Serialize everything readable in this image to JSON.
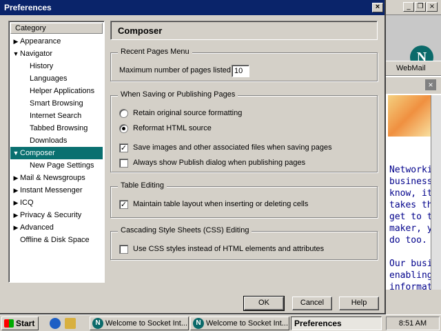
{
  "dialog": {
    "title": "Preferences",
    "close_glyph": "×",
    "category_header": "Category",
    "panel_title": "Composer",
    "buttons": {
      "ok": "OK",
      "cancel": "Cancel",
      "help": "Help"
    }
  },
  "tree": [
    {
      "label": "Appearance",
      "twisty": "▶",
      "selected": false
    },
    {
      "label": "Navigator",
      "twisty": "▼",
      "selected": false
    },
    {
      "label": "History",
      "twisty": "",
      "selected": false
    },
    {
      "label": "Languages",
      "twisty": "",
      "selected": false
    },
    {
      "label": "Helper Applications",
      "twisty": "",
      "selected": false
    },
    {
      "label": "Smart Browsing",
      "twisty": "",
      "selected": false
    },
    {
      "label": "Internet Search",
      "twisty": "",
      "selected": false
    },
    {
      "label": "Tabbed Browsing",
      "twisty": "",
      "selected": false
    },
    {
      "label": "Downloads",
      "twisty": "",
      "selected": false
    },
    {
      "label": "Composer",
      "twisty": "▼",
      "selected": true
    },
    {
      "label": "New Page Settings",
      "twisty": "",
      "selected": false
    },
    {
      "label": "Mail & Newsgroups",
      "twisty": "▶",
      "selected": false
    },
    {
      "label": "Instant Messenger",
      "twisty": "▶",
      "selected": false
    },
    {
      "label": "ICQ",
      "twisty": "▶",
      "selected": false
    },
    {
      "label": "Privacy & Security",
      "twisty": "▶",
      "selected": false
    },
    {
      "label": "Advanced",
      "twisty": "▶",
      "selected": false
    },
    {
      "label": "Offline & Disk Space",
      "twisty": "",
      "selected": false
    }
  ],
  "recent_pages": {
    "legend": "Recent Pages Menu",
    "max_label": "Maximum number of pages listed:",
    "max_value": "10"
  },
  "saving": {
    "legend": "When Saving or Publishing Pages",
    "retain_label": "Retain original source formatting",
    "retain_selected": false,
    "reformat_label": "Reformat HTML source",
    "reformat_selected": true,
    "save_images_label": "Save images and other associated files when saving pages",
    "save_images_checked": true,
    "publish_dialog_label": "Always show Publish dialog when publishing pages",
    "publish_dialog_checked": false
  },
  "table_editing": {
    "legend": "Table Editing",
    "maintain_label": "Maintain table layout when inserting or deleting cells",
    "maintain_checked": true
  },
  "css_editing": {
    "legend": "Cascading Style Sheets (CSS) Editing",
    "use_css_label": "Use CSS styles instead of HTML elements and attributes",
    "use_css_checked": false
  },
  "background_window": {
    "webmail": "WebMail",
    "logo_letter": "N",
    "text_lines": [
      "Networkin",
      "business.",
      "know, it's",
      "takes the",
      "get to th",
      "maker, yo",
      "do too.",
      "",
      "Our busin",
      "enabling",
      "informatio"
    ]
  },
  "taskbar": {
    "start": "Start",
    "tasks": [
      "Welcome to Socket Int...",
      "Welcome to Socket Int...",
      "Preferences"
    ],
    "clock": "8:51 AM"
  },
  "colors": {
    "titlebar": "#0a246a",
    "selection": "#0a7070",
    "face": "#d4d0c8"
  }
}
